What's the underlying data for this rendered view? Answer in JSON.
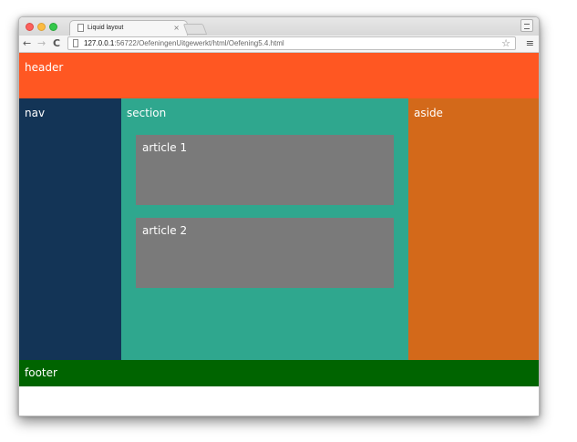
{
  "browser": {
    "tab": {
      "title": "Liquid layout",
      "close_glyph": "×"
    },
    "toolbar": {
      "back_glyph": "←",
      "forward_glyph": "→",
      "reload_glyph": "C",
      "url_host": "127.0.0.1",
      "url_rest": ":56722/OefeningenUitgewerkt/html/Oefening5.4.html",
      "bookmark_glyph": "☆",
      "menu_glyph": "≡"
    },
    "icons": [
      "page-icon",
      "close-icon",
      "back-arrow-icon",
      "forward-arrow-icon",
      "reload-icon",
      "star-icon",
      "menu-icon",
      "profile-icon"
    ]
  },
  "page": {
    "header": {
      "label": "header",
      "color": "#ff5722"
    },
    "nav": {
      "label": "nav",
      "color": "#133456"
    },
    "section": {
      "label": "section",
      "color": "#2fa78e",
      "articles": [
        {
          "label": "article 1",
          "color": "#7a7a7a"
        },
        {
          "label": "article 2",
          "color": "#7a7a7a"
        }
      ]
    },
    "aside": {
      "label": "aside",
      "color": "#d3691a"
    },
    "footer": {
      "label": "footer",
      "color": "#006400"
    }
  }
}
